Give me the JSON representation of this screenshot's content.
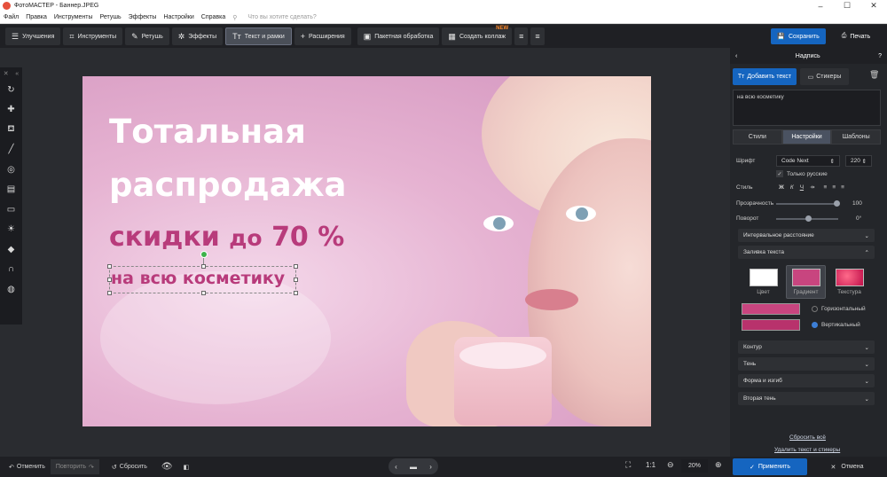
{
  "titlebar": {
    "title": "ФотоМАСТЕР - Баннер.JPEG"
  },
  "menu": {
    "items": [
      "Файл",
      "Правка",
      "Инструменты",
      "Ретушь",
      "Эффекты",
      "Настройки",
      "Справка"
    ],
    "search_placeholder": "Что вы хотите сделать?"
  },
  "toolbar": {
    "tabs": [
      "Улучшения",
      "Инструменты",
      "Ретушь",
      "Эффекты",
      "Текст и рамки",
      "Расширения"
    ],
    "batch": "Пакетная обработка",
    "collage": "Создать коллаж",
    "collage_badge": "NEW",
    "save": "Сохранить",
    "print": "Печать"
  },
  "banner": {
    "line1": "Тотальная",
    "line2": "распродажа",
    "line3a": "скидки",
    "line3b": "до",
    "line3c": "70 %",
    "line4": "на всю косметику"
  },
  "panel": {
    "title": "Надпись",
    "add_text": "Добавить текст",
    "stickers": "Стикеры",
    "text_value": "на всю косметику",
    "tabs": [
      "Стили",
      "Настройки",
      "Шаблоны"
    ],
    "font_label": "Шрифт",
    "font_value": "Code Next",
    "font_size": "220",
    "only_russian": "Только русские",
    "style_label": "Стиль",
    "opacity_label": "Прозрачность",
    "opacity_value": "100",
    "rotation_label": "Поворот",
    "rotation_value": "0°",
    "spacing": "Интервальное расстояние",
    "fill": "Заливка текста",
    "fill_opts": [
      "Цвет",
      "Градиент",
      "Текстура"
    ],
    "horizontal": "Горизонтальный",
    "vertical": "Вертикальный",
    "contour": "Контур",
    "shadow": "Тень",
    "shape": "Форма и изгиб",
    "second_shadow": "Вторая тень",
    "reset_all": "Сбросить всё",
    "delete": "Удалить текст и стикеры",
    "apply": "Применить",
    "cancel": "Отмена"
  },
  "bottom": {
    "undo": "Отменить",
    "redo": "Повторить",
    "reset": "Сбросить",
    "ratio": "1:1",
    "zoom": "20%"
  },
  "colors": {
    "accent": "#1565c0",
    "banner_pink": "#b83b7b",
    "grad1": "#c8457f",
    "grad2": "#b8326c"
  }
}
